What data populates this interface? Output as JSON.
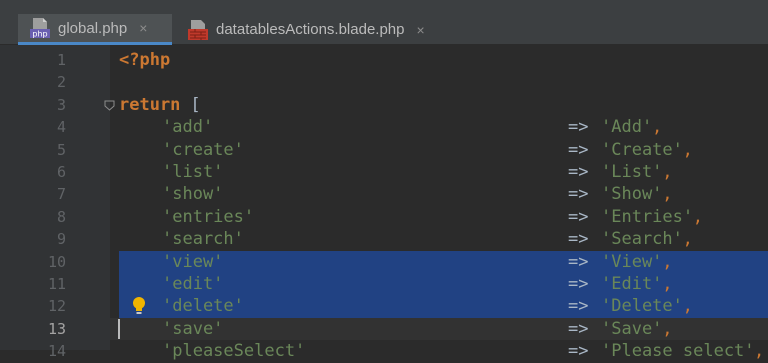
{
  "tabs": [
    {
      "label": "global.php",
      "icon": "php-file-icon",
      "icon_text": "php",
      "active": true
    },
    {
      "label": "datatablesActions.blade.php",
      "icon": "blade-file-icon",
      "active": false
    }
  ],
  "close_glyph": "×",
  "lines": [
    {
      "num": "1",
      "tokens": [
        {
          "t": "<?php",
          "c": "tag"
        }
      ]
    },
    {
      "num": "2",
      "tokens": []
    },
    {
      "num": "3",
      "tokens": [
        {
          "t": "return",
          "c": "kw"
        },
        {
          "t": " [",
          "c": "op"
        }
      ]
    },
    {
      "num": "4",
      "key": "'add'",
      "value": "'Add'"
    },
    {
      "num": "5",
      "key": "'create'",
      "value": "'Create'"
    },
    {
      "num": "6",
      "key": "'list'",
      "value": "'List'"
    },
    {
      "num": "7",
      "key": "'show'",
      "value": "'Show'"
    },
    {
      "num": "8",
      "key": "'entries'",
      "value": "'Entries'"
    },
    {
      "num": "9",
      "key": "'search'",
      "value": "'Search'"
    },
    {
      "num": "10",
      "key": "'view'",
      "value": "'View'",
      "selected": true
    },
    {
      "num": "11",
      "key": "'edit'",
      "value": "'Edit'",
      "selected": true
    },
    {
      "num": "12",
      "key": "'delete'",
      "value": "'Delete'",
      "selected": true
    },
    {
      "num": "13",
      "key": "'save'",
      "value": "'Save'",
      "current": true
    },
    {
      "num": "14",
      "key": "'pleaseSelect'",
      "value": "'Please select'"
    }
  ],
  "arrow": "=>",
  "colors": {
    "background": "#2b2b2b",
    "gutter": "#313335",
    "selection": "#214283",
    "keyword": "#cc7832",
    "string": "#6a8759",
    "text": "#a9b7c6",
    "line_number": "#606366"
  }
}
